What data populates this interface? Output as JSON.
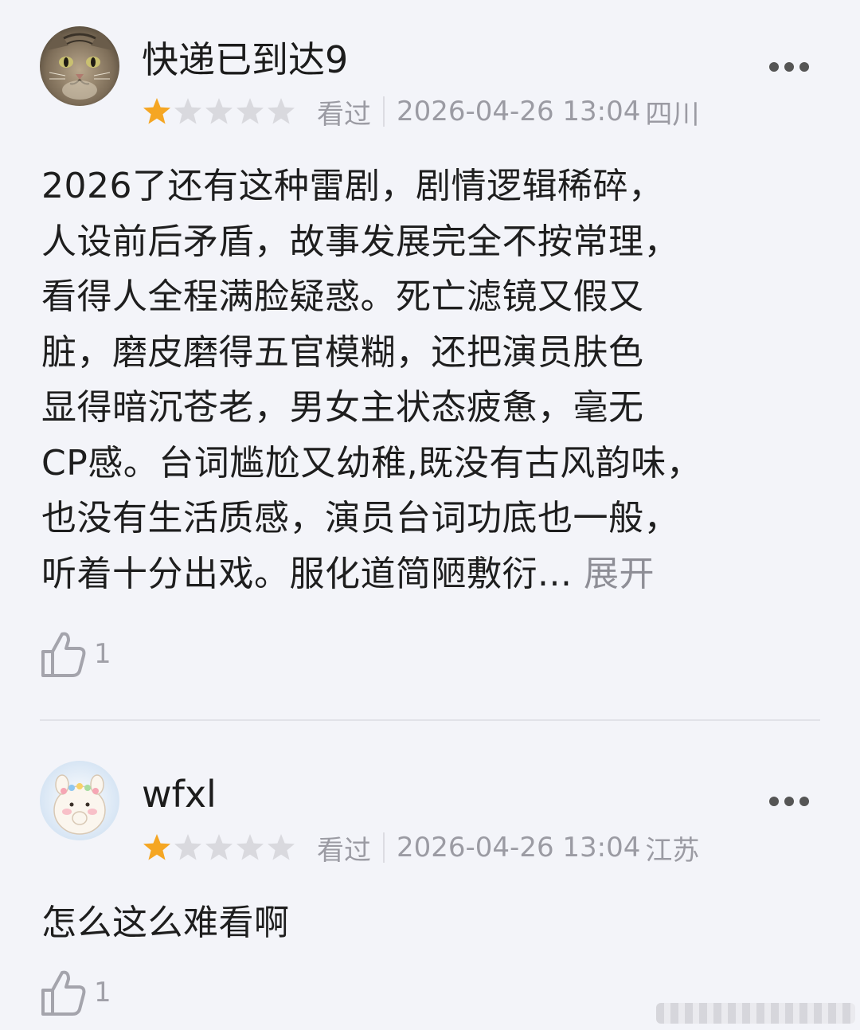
{
  "reviews": [
    {
      "username": "快递已到达9",
      "rating": 1,
      "rating_max": 5,
      "status": "看过",
      "timestamp": "2026-04-26 13:04",
      "location": "四川",
      "content_lines": [
        "2026了还有这种雷剧，剧情逻辑稀碎，",
        "人设前后矛盾，故事发展完全不按常理，",
        "看得人全程满脸疑惑。死亡滤镜又假又",
        "脏，磨皮磨得五官模糊，还把演员肤色",
        "显得暗沉苍老，男女主状态疲惫，毫无",
        "CP感。台词尴尬又幼稚,既没有古风韵味，",
        "也没有生活质感，演员台词功底也一般，",
        "听着十分出戏。服化道简陋敷衍..."
      ],
      "expand_label": "展开",
      "like_count": "1",
      "avatar_icon": "cat-avatar-icon"
    },
    {
      "username": "wfxl",
      "rating": 1,
      "rating_max": 5,
      "status": "看过",
      "timestamp": "2026-04-26 13:04",
      "location": "江苏",
      "content_lines": [
        "怎么这么难看啊"
      ],
      "like_count": "1",
      "avatar_icon": "bunny-avatar-icon"
    }
  ],
  "colors": {
    "background": "#f3f4f9",
    "star_filled": "#f5a623",
    "star_empty": "#d9d9de",
    "meta_text": "#9b9ba3",
    "expand_text": "#8e8e96"
  }
}
